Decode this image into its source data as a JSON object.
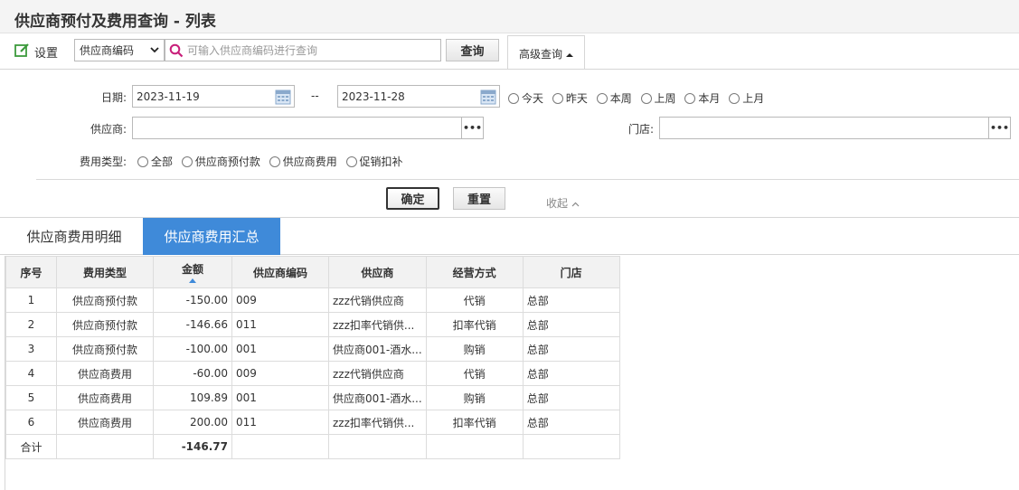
{
  "page": {
    "title": "供应商预付及费用查询 - 列表"
  },
  "toolbar": {
    "settings_label": "设置",
    "search_field": "供应商编码",
    "search_placeholder": "可输入供应商编码进行查询",
    "query_label": "查询",
    "advanced_label": "高级查询"
  },
  "filters": {
    "date_label": "日期:",
    "date_from": "2023-11-19",
    "date_sep": "--",
    "date_to": "2023-11-28",
    "quick_dates": [
      "今天",
      "昨天",
      "本周",
      "上周",
      "本月",
      "上月"
    ],
    "supplier_label": "供应商:",
    "supplier_value": "",
    "store_label": "门店:",
    "store_value": "",
    "more_glyph": "•••",
    "fee_type_label": "费用类型:",
    "fee_types": [
      "全部",
      "供应商预付款",
      "供应商费用",
      "促销扣补"
    ],
    "confirm_label": "确定",
    "reset_label": "重置",
    "collapse_label": "收起"
  },
  "tabs": {
    "detail": "供应商费用明细",
    "summary": "供应商费用汇总"
  },
  "table": {
    "headers": {
      "seq": "序号",
      "fee_type": "费用类型",
      "amount": "金额",
      "supplier_code": "供应商编码",
      "supplier": "供应商",
      "mode": "经营方式",
      "store": "门店"
    },
    "rows": [
      {
        "seq": "1",
        "fee_type": "供应商预付款",
        "amount": "-150.00",
        "supplier_code": "009",
        "supplier": "zzz代销供应商",
        "mode": "代销",
        "store": "总部"
      },
      {
        "seq": "2",
        "fee_type": "供应商预付款",
        "amount": "-146.66",
        "supplier_code": "011",
        "supplier": "zzz扣率代销供...",
        "mode": "扣率代销",
        "store": "总部"
      },
      {
        "seq": "3",
        "fee_type": "供应商预付款",
        "amount": "-100.00",
        "supplier_code": "001",
        "supplier": "供应商001-酒水...",
        "mode": "购销",
        "store": "总部"
      },
      {
        "seq": "4",
        "fee_type": "供应商费用",
        "amount": "-60.00",
        "supplier_code": "009",
        "supplier": "zzz代销供应商",
        "mode": "代销",
        "store": "总部"
      },
      {
        "seq": "5",
        "fee_type": "供应商费用",
        "amount": "109.89",
        "supplier_code": "001",
        "supplier": "供应商001-酒水...",
        "mode": "购销",
        "store": "总部"
      },
      {
        "seq": "6",
        "fee_type": "供应商费用",
        "amount": "200.00",
        "supplier_code": "011",
        "supplier": "zzz扣率代销供...",
        "mode": "扣率代销",
        "store": "总部"
      }
    ],
    "total_label": "合计",
    "total_amount": "-146.77"
  },
  "colors": {
    "accent": "#3f8ad9",
    "search_icon": "#c81f7a",
    "settings_icon": "#3c9a3c"
  }
}
